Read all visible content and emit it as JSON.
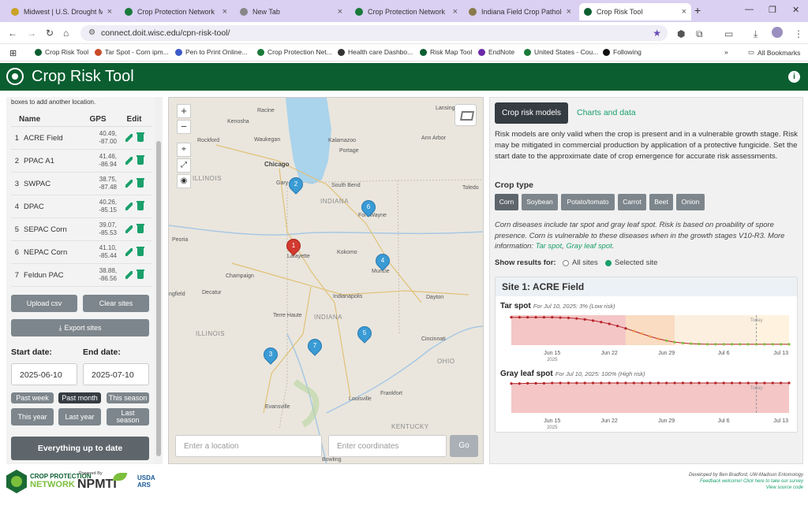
{
  "browser": {
    "tabs": [
      {
        "title": "Midwest | U.S. Drought Mo",
        "color": "#c9a227"
      },
      {
        "title": "Crop Protection Network",
        "color": "#1a7a3a"
      },
      {
        "title": "New Tab",
        "color": "#888888"
      },
      {
        "title": "Crop Protection Network",
        "color": "#1a7a3a"
      },
      {
        "title": "Indiana Field Crop Patholog",
        "color": "#8a7a4a"
      },
      {
        "title": "Crop Risk Tool",
        "color": "#0b5e30"
      }
    ],
    "url": "connect.doit.wisc.edu/cpn-risk-tool/",
    "bookmarks": [
      "Crop Risk Tool",
      "Tar Spot - Corn ipm...",
      "Pen to Print Online...",
      "Crop Protection Net...",
      "Health care Dashbo...",
      "Risk Map Tool",
      "EndNote",
      "United States - Cou...",
      "Following"
    ],
    "all_bookmarks": "All Bookmarks",
    "overflow": "»"
  },
  "app": {
    "title": "Crop Risk Tool",
    "theme_color": "#0b5e30",
    "accent_color": "#1aa06b"
  },
  "sites_panel": {
    "hint": "boxes to add another location.",
    "headers": {
      "name": "Name",
      "gps": "GPS",
      "edit": "Edit"
    },
    "sites": [
      {
        "num": "1",
        "name": "ACRE Field",
        "lat": "40.49,",
        "lon": "-87.00"
      },
      {
        "num": "2",
        "name": "PPAC A1",
        "lat": "41.46,",
        "lon": "-86.94"
      },
      {
        "num": "3",
        "name": "SWPAC",
        "lat": "38.75,",
        "lon": "-87.48"
      },
      {
        "num": "4",
        "name": "DPAC",
        "lat": "40.26,",
        "lon": "-85.15"
      },
      {
        "num": "5",
        "name": "SEPAC Corn",
        "lat": "39.07,",
        "lon": "-85.53"
      },
      {
        "num": "6",
        "name": "NEPAC Corn",
        "lat": "41.10,",
        "lon": "-85.44"
      },
      {
        "num": "7",
        "name": "Feldun PAC",
        "lat": "38.88,",
        "lon": "-86.56"
      }
    ],
    "upload_csv": "Upload csv",
    "clear_sites": "Clear sites",
    "export_sites": "Export sites",
    "start_date_label": "Start date:",
    "end_date_label": "End date:",
    "start_date": "2025-06-10",
    "end_date": "2025-07-10",
    "presets": {
      "past_week": "Past week",
      "past_month": "Past month",
      "this_season": "This season",
      "this_year": "This year",
      "last_year": "Last year",
      "last_season": "Last season"
    },
    "everything": "Everything up to date"
  },
  "map": {
    "zoom_in": "+",
    "zoom_out": "−",
    "location_placeholder": "Enter a location",
    "coords_placeholder": "Enter coordinates",
    "go": "Go",
    "cities": [
      "Racine",
      "Lansing",
      "Kenosha",
      "Waukegan",
      "Kalamazoo",
      "Ann Arbor",
      "Rockford",
      "Portage",
      "Chicago",
      "Gary",
      "South Bend",
      "Toledo",
      "Fort Wayne",
      "Peoria",
      "Lafayette",
      "Kokomo",
      "Champaign",
      "Muncie",
      "Decatur",
      "Indianapolis",
      "Dayton",
      "Terre Haute",
      "Cincinnati",
      "Evansville",
      "Louisville",
      "Frankfort",
      "Bowling",
      "ngfield"
    ],
    "states": [
      "ILLINOIS",
      "INDIANA",
      "ILLINOIS",
      "INDIANA",
      "OHIO",
      "KENTUCKY"
    ],
    "pins": [
      "1",
      "2",
      "3",
      "4",
      "5",
      "6",
      "7"
    ]
  },
  "risk_panel": {
    "tab_models": "Crop risk models",
    "tab_charts": "Charts and data",
    "description": "Risk models are only valid when the crop is present and in a vulnerable growth stage. Risk may be mitigated in commercial production by application of a protective fungicide. Set the start date to the approximate date of crop emergence for accurate risk assessments.",
    "crop_type_label": "Crop type",
    "crops": [
      "Corn",
      "Soybean",
      "Potato/tomato",
      "Carrot",
      "Beet",
      "Onion"
    ],
    "crop_desc": "Corn diseases include tar spot and gray leaf spot. Risk is based on proability of spore presence. Corn is vulnerable to these diseases when in the growth stages V10-R3. More information: ",
    "link_tar": "Tar spot",
    "link_gls": "Gray leaf spot",
    "comma": ", ",
    "period": ".",
    "show_results": "Show results for:",
    "radio_all": "All sites",
    "radio_selected": "Selected site",
    "site_title": "Site 1: ACRE Field",
    "charts": [
      {
        "name": "Tar spot",
        "note": "For Jul 10, 2025: 3% (Low risk)"
      },
      {
        "name": "Gray leaf spot",
        "note": "For Jul 10, 2025: 100% (High risk)"
      }
    ]
  },
  "chart_data": [
    {
      "type": "line",
      "title": "Tar spot",
      "x_ticks": [
        "Jun 15",
        "Jun 22",
        "Jun 29",
        "Jul 6",
        "Jul 13"
      ],
      "year_label": "2025",
      "today_label": "Today",
      "x": [
        "Jun 10",
        "Jun 11",
        "Jun 12",
        "Jun 13",
        "Jun 14",
        "Jun 15",
        "Jun 16",
        "Jun 17",
        "Jun 18",
        "Jun 19",
        "Jun 20",
        "Jun 21",
        "Jun 22",
        "Jun 23",
        "Jun 24",
        "Jun 25",
        "Jun 26",
        "Jun 27",
        "Jun 28",
        "Jun 29",
        "Jun 30",
        "Jul 1",
        "Jul 2",
        "Jul 3",
        "Jul 4",
        "Jul 5",
        "Jul 6",
        "Jul 7",
        "Jul 8",
        "Jul 9",
        "Jul 10",
        "Jul 11",
        "Jul 12",
        "Jul 13",
        "Jul 14"
      ],
      "values": [
        0.93,
        0.93,
        0.93,
        0.93,
        0.93,
        0.93,
        0.92,
        0.91,
        0.89,
        0.86,
        0.82,
        0.77,
        0.71,
        0.64,
        0.56,
        0.47,
        0.38,
        0.29,
        0.21,
        0.15,
        0.1,
        0.07,
        0.05,
        0.04,
        0.03,
        0.03,
        0.03,
        0.03,
        0.03,
        0.03,
        0.03,
        0.03,
        0.03,
        0.03,
        0.03
      ],
      "ylim": [
        0,
        1
      ],
      "colors": {
        "high": "#f4c6c6",
        "medium": "#f9dcc2",
        "low": "#fcefe0",
        "forecast": "#fff3df",
        "line": "#b5242a"
      }
    },
    {
      "type": "line",
      "title": "Gray leaf spot",
      "x_ticks": [
        "Jun 15",
        "Jun 22",
        "Jun 29",
        "Jul 6",
        "Jul 13"
      ],
      "year_label": "2025",
      "today_label": "Today",
      "x": [
        "Jun 10",
        "Jun 11",
        "Jun 12",
        "Jun 13",
        "Jun 14",
        "Jun 15",
        "Jun 16",
        "Jun 17",
        "Jun 18",
        "Jun 19",
        "Jun 20",
        "Jun 21",
        "Jun 22",
        "Jun 23",
        "Jun 24",
        "Jun 25",
        "Jun 26",
        "Jun 27",
        "Jun 28",
        "Jun 29",
        "Jun 30",
        "Jul 1",
        "Jul 2",
        "Jul 3",
        "Jul 4",
        "Jul 5",
        "Jul 6",
        "Jul 7",
        "Jul 8",
        "Jul 9",
        "Jul 10",
        "Jul 11",
        "Jul 12",
        "Jul 13",
        "Jul 14"
      ],
      "values": [
        0.98,
        0.98,
        0.99,
        0.99,
        0.99,
        1,
        1,
        1,
        1,
        1,
        1,
        1,
        1,
        1,
        1,
        1,
        1,
        1,
        1,
        1,
        1,
        1,
        1,
        1,
        1,
        1,
        1,
        1,
        1,
        1,
        1,
        1,
        1,
        1,
        1
      ],
      "ylim": [
        0,
        1
      ],
      "colors": {
        "high": "#f4c6c6",
        "line": "#b5242a"
      }
    }
  ],
  "footer": {
    "cpn_line1": "CROP PROTECTION",
    "cpn_line2": "NETWORK",
    "powered_by": "Powered By",
    "npmti": "NPMTI",
    "usda": "USDA",
    "ars": "ARS",
    "credit1": "Developed by Ben Bradford, UW-Madison Entomology",
    "credit2": "Feedback welcome! Click here to take our survey",
    "credit3": "View source code"
  }
}
